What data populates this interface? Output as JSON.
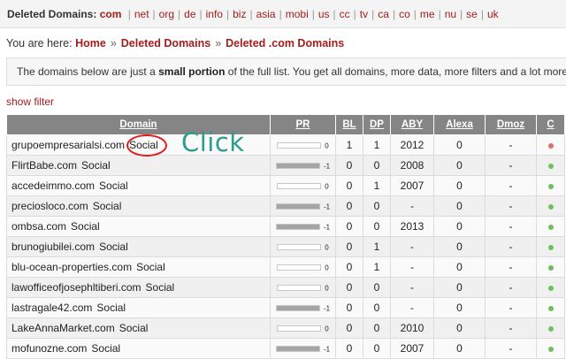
{
  "tld_bar": {
    "label": "Deleted Domains:",
    "current": "com",
    "items": [
      "net",
      "org",
      "de",
      "info",
      "biz",
      "asia",
      "mobi",
      "us",
      "cc",
      "tv",
      "ca",
      "co",
      "me",
      "nu",
      "se",
      "uk"
    ]
  },
  "breadcrumb": {
    "prefix": "You are here:",
    "items": [
      "Home",
      "Deleted Domains",
      "Deleted .com Domains"
    ],
    "separator": "»"
  },
  "notice": {
    "text_before": "The domains below are just a ",
    "bold": "small portion",
    "text_after": " of the full list. You get all domains, more data, more filters and a lot more"
  },
  "show_filter": "show filter",
  "table": {
    "columns": [
      "Domain",
      "PR",
      "BL",
      "DP",
      "ABY",
      "Alexa",
      "Dmoz",
      "C"
    ],
    "social_label": "Social",
    "rows": [
      {
        "domain": "grupoempresarialsi.com",
        "pr": "0",
        "pr_fill": 0.0,
        "bl": "1",
        "dp": "1",
        "aby": "2012",
        "alexa": "0",
        "dmoz": "-",
        "status": "red"
      },
      {
        "domain": "FlirtBabe.com",
        "pr": "-1",
        "pr_fill": 1.0,
        "bl": "0",
        "dp": "0",
        "aby": "2008",
        "alexa": "0",
        "dmoz": "-",
        "status": "green"
      },
      {
        "domain": "accedeimmo.com",
        "pr": "0",
        "pr_fill": 0.0,
        "bl": "0",
        "dp": "1",
        "aby": "2007",
        "alexa": "0",
        "dmoz": "-",
        "status": "green"
      },
      {
        "domain": "preciosloco.com",
        "pr": "-1",
        "pr_fill": 1.0,
        "bl": "0",
        "dp": "0",
        "aby": "-",
        "alexa": "0",
        "dmoz": "-",
        "status": "green"
      },
      {
        "domain": "ombsa.com",
        "pr": "-1",
        "pr_fill": 1.0,
        "bl": "0",
        "dp": "0",
        "aby": "2013",
        "alexa": "0",
        "dmoz": "-",
        "status": "green"
      },
      {
        "domain": "brunogiubilei.com",
        "pr": "0",
        "pr_fill": 0.0,
        "bl": "0",
        "dp": "1",
        "aby": "-",
        "alexa": "0",
        "dmoz": "-",
        "status": "green"
      },
      {
        "domain": "blu-ocean-properties.com",
        "pr": "0",
        "pr_fill": 0.0,
        "bl": "0",
        "dp": "1",
        "aby": "-",
        "alexa": "0",
        "dmoz": "-",
        "status": "green"
      },
      {
        "domain": "lawofficeofjosephltiberi.com",
        "pr": "0",
        "pr_fill": 0.0,
        "bl": "0",
        "dp": "0",
        "aby": "-",
        "alexa": "0",
        "dmoz": "-",
        "status": "green"
      },
      {
        "domain": "lastragale42.com",
        "pr": "-1",
        "pr_fill": 1.0,
        "bl": "0",
        "dp": "0",
        "aby": "-",
        "alexa": "0",
        "dmoz": "-",
        "status": "green"
      },
      {
        "domain": "LakeAnnaMarket.com",
        "pr": "0",
        "pr_fill": 0.0,
        "bl": "0",
        "dp": "0",
        "aby": "2010",
        "alexa": "0",
        "dmoz": "-",
        "status": "green"
      },
      {
        "domain": "mofunozne.com",
        "pr": "-1",
        "pr_fill": 1.0,
        "bl": "0",
        "dp": "0",
        "aby": "2007",
        "alexa": "0",
        "dmoz": "-",
        "status": "green"
      }
    ]
  },
  "annotation": {
    "text": "Click"
  },
  "colors": {
    "link": "#a31d1d",
    "header_bg": "#858585",
    "status_red": "#e07070",
    "status_green": "#6cc25a",
    "annotation_circle": "#e11b1b",
    "annotation_text": "#2a9d8f"
  }
}
